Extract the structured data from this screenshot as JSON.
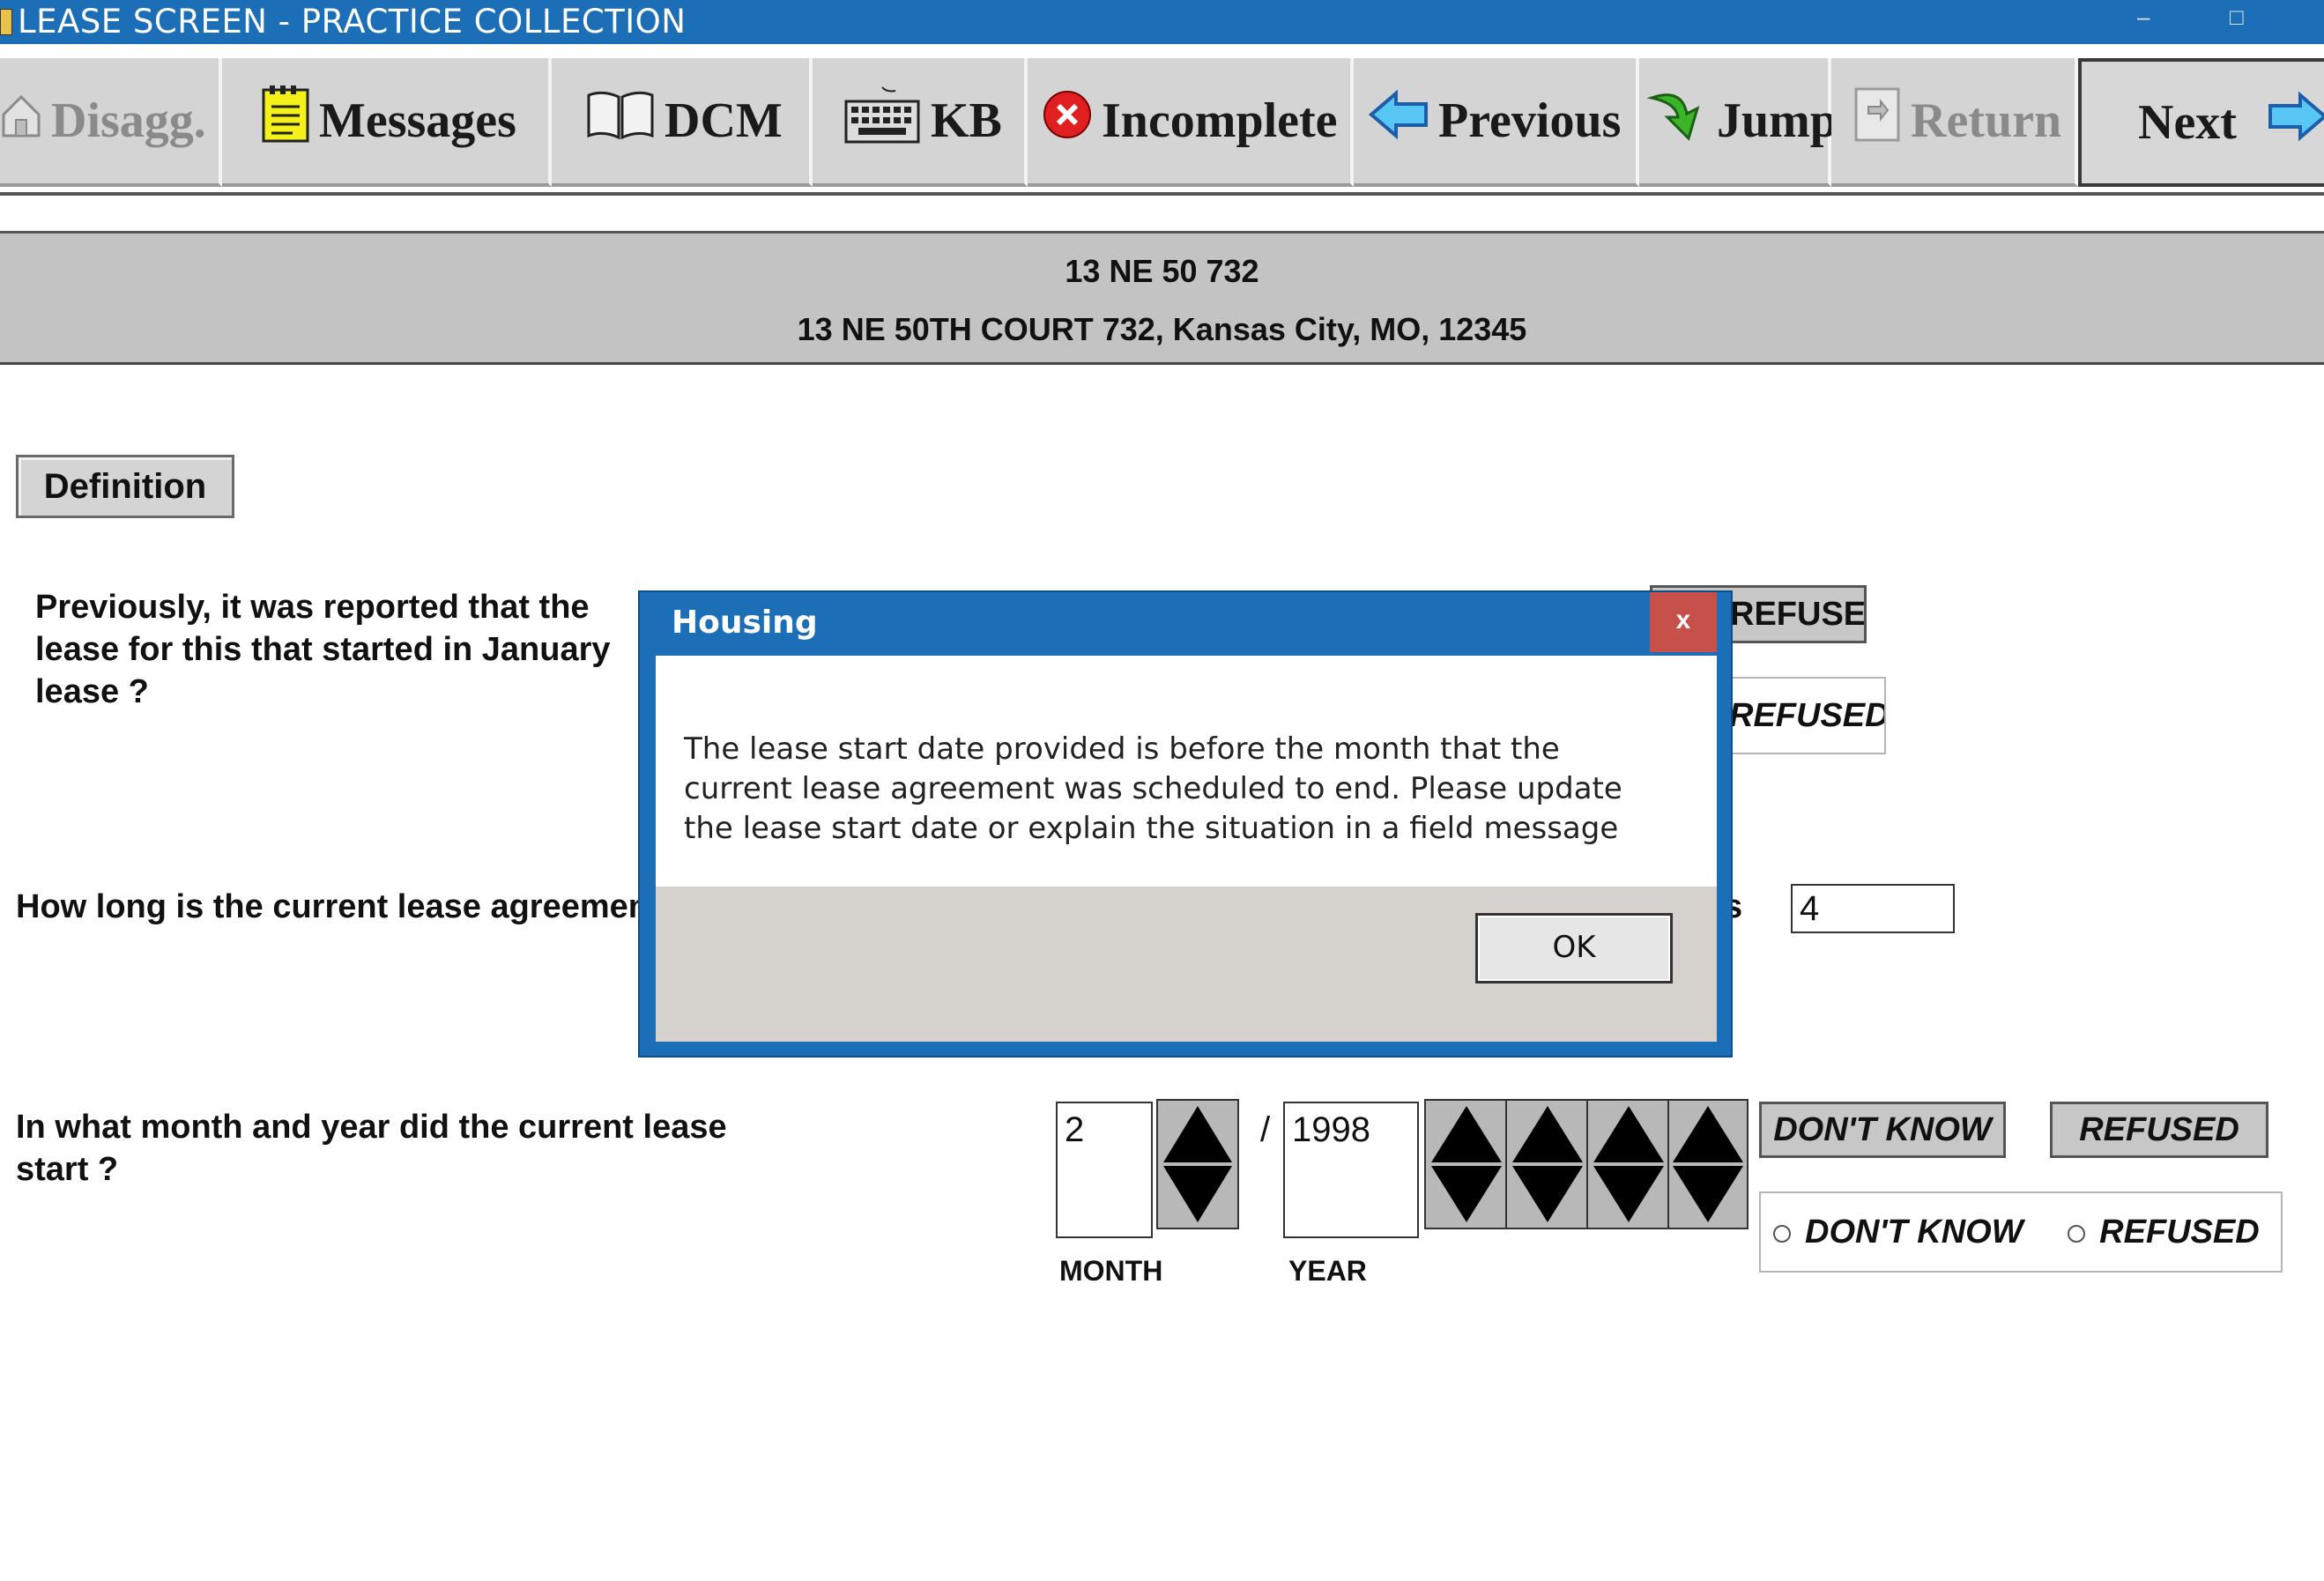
{
  "window": {
    "title": "LEASE SCREEN - PRACTICE COLLECTION",
    "minimize_glyph": "–",
    "maximize_glyph": "□"
  },
  "toolbar": {
    "disagg": "Disagg.",
    "messages": "Messages",
    "dcm": "DCM",
    "kb": "KB",
    "incomplete": "Incomplete",
    "previous": "Previous",
    "jump": "Jump",
    "return": "Return",
    "next": "Next"
  },
  "address": {
    "line1": "13 NE 50 732",
    "line2": "13 NE 50TH COURT 732, Kansas City, MO, 12345"
  },
  "definition_button": "Definition",
  "question1": {
    "text": "Previously, it was reported that  the lease for this  that started in January lease ?",
    "refused_button": "REFUSED",
    "refused_radio": "REFUSED"
  },
  "question2": {
    "text": "How long is the current lease agreement",
    "unit_label": "s",
    "value": "4"
  },
  "question3": {
    "text": "In what month and year did the current lease start ?",
    "month_value": "2",
    "separator": "/",
    "year_value": "1998",
    "month_label": "MONTH",
    "year_label": "YEAR",
    "dont_know_button": "DON'T KNOW",
    "refused_button": "REFUSED",
    "dont_know_radio": "DON'T KNOW",
    "refused_radio": "REFUSED"
  },
  "dialog": {
    "title": "Housing",
    "close": "x",
    "message": "The lease start date provided is before the month that the current lease agreement was scheduled to end.   Please update the lease start date or explain the situation in a field message",
    "ok": "OK"
  },
  "colors": {
    "titlebar": "#1c6fb7",
    "toolbar_button": "#d4d4d4",
    "address_band": "#c3c3c3",
    "dialog_close": "#c7504a",
    "dialog_footer": "#d5d1cc"
  }
}
